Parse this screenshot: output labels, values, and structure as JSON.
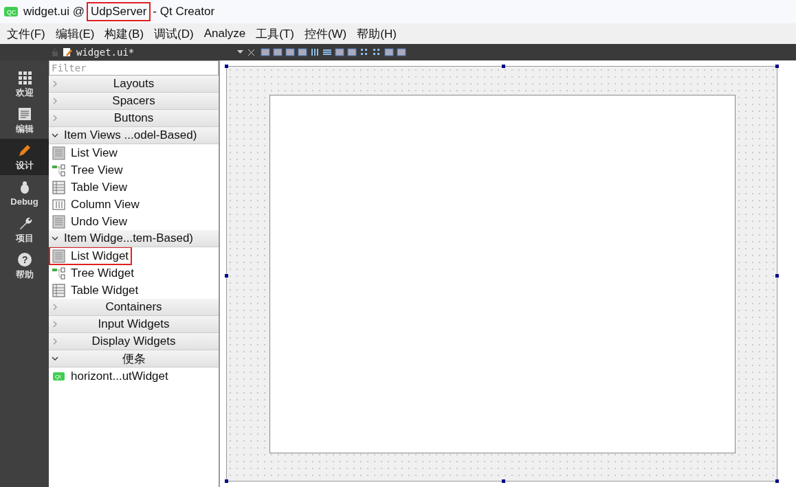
{
  "window": {
    "badge": "QC",
    "title_parts": [
      {
        "text": "widget.ui @",
        "highlighted": false
      },
      {
        "text": "UdpServer",
        "highlighted": true
      },
      {
        "text": "- Qt Creator",
        "highlighted": false
      }
    ]
  },
  "menu": [
    "文件(F)",
    "编辑(E)",
    "构建(B)",
    "调试(D)",
    "Analyze",
    "工具(T)",
    "控件(W)",
    "帮助(H)"
  ],
  "editor_tab": {
    "file": "widget.ui*"
  },
  "modes": [
    {
      "label": "欢迎",
      "selected": false
    },
    {
      "label": "编辑",
      "selected": false
    },
    {
      "label": "设计",
      "selected": true
    },
    {
      "label": "Debug",
      "selected": false
    },
    {
      "label": "项目",
      "selected": false
    },
    {
      "label": "帮助",
      "selected": false,
      "glyph": "?"
    }
  ],
  "widget_box": {
    "filter": {
      "placeholder": "Filter"
    },
    "categories": [
      {
        "label": "Layouts",
        "expanded": false
      },
      {
        "label": "Spacers",
        "expanded": false
      },
      {
        "label": "Buttons",
        "expanded": false
      },
      {
        "label": "Item Views ...odel-Based)",
        "expanded": true,
        "items": [
          {
            "label": "List View",
            "kind": "list",
            "highlighted": false
          },
          {
            "label": "Tree View",
            "kind": "tree",
            "highlighted": false
          },
          {
            "label": "Table View",
            "kind": "table",
            "highlighted": false
          },
          {
            "label": "Column View",
            "kind": "column",
            "highlighted": false
          },
          {
            "label": "Undo View",
            "kind": "list",
            "highlighted": false
          }
        ]
      },
      {
        "label": "Item Widge...tem-Based)",
        "expanded": true,
        "items": [
          {
            "label": "List Widget",
            "kind": "list",
            "highlighted": true
          },
          {
            "label": "Tree Widget",
            "kind": "tree",
            "highlighted": false
          },
          {
            "label": "Table Widget",
            "kind": "table",
            "highlighted": false
          }
        ]
      },
      {
        "label": "Containers",
        "expanded": false
      },
      {
        "label": "Input Widgets",
        "expanded": false
      },
      {
        "label": "Display Widgets",
        "expanded": false
      },
      {
        "label": "便条",
        "expanded": true,
        "items": [
          {
            "label": "horizont...utWidget",
            "kind": "custom",
            "badge": "Qt",
            "highlighted": false
          }
        ]
      }
    ]
  }
}
